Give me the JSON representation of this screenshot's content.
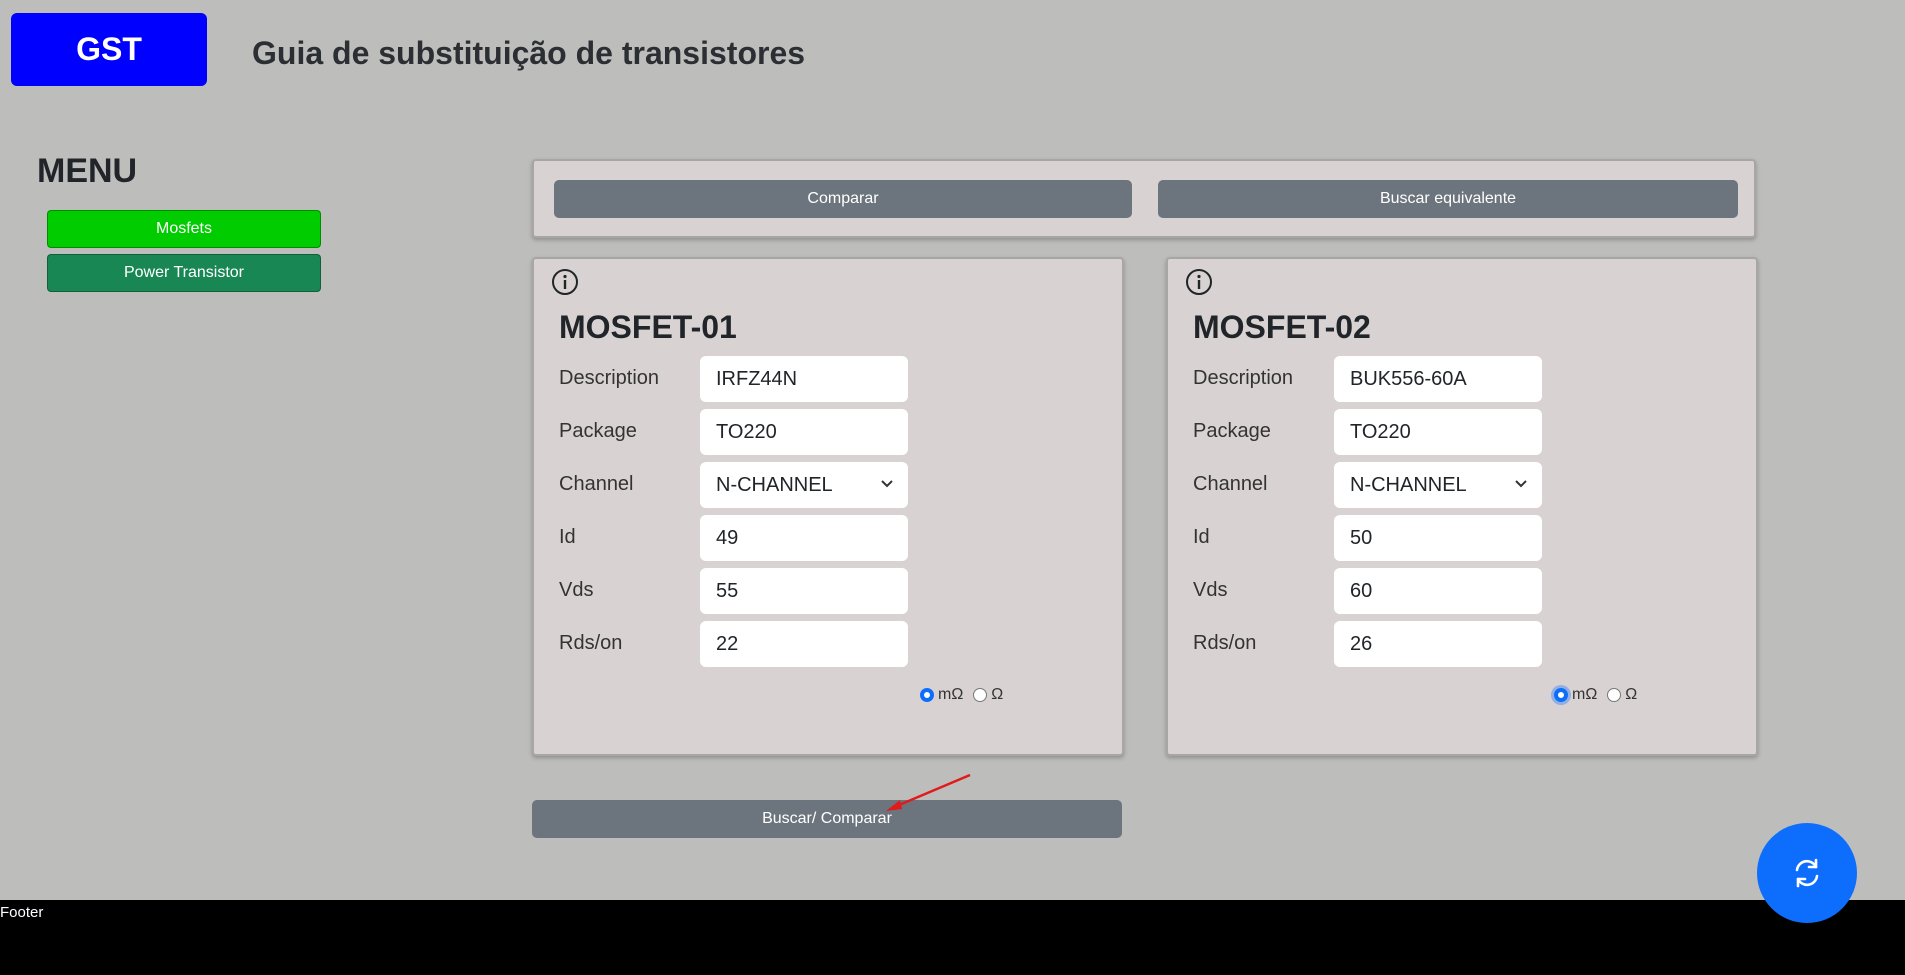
{
  "header": {
    "logo_text": "GST",
    "title": "Guia de substituição de transistores"
  },
  "menu": {
    "title": "MENU",
    "items": [
      {
        "label": "Mosfets",
        "color": "#00cc00"
      },
      {
        "label": "Power Transistor",
        "color": "#198754"
      }
    ]
  },
  "toolbar": {
    "compare_label": "Comparar",
    "find_equivalent_label": "Buscar equivalente"
  },
  "labels": {
    "description": "Description",
    "package": "Package",
    "channel": "Channel",
    "id": "Id",
    "vds": "Vds",
    "rds_on": "Rds/on",
    "unit_mohm": "mΩ",
    "unit_ohm": "Ω"
  },
  "cards": [
    {
      "title": "MOSFET-01",
      "description": "IRFZ44N",
      "package": "TO220",
      "channel": "N-CHANNEL",
      "id": "49",
      "vds": "55",
      "rds_on": "22",
      "unit_selected": "mΩ"
    },
    {
      "title": "MOSFET-02",
      "description": "BUK556-60A",
      "package": "TO220",
      "channel": "N-CHANNEL",
      "id": "50",
      "vds": "60",
      "rds_on": "26",
      "unit_selected": "mΩ"
    }
  ],
  "actions": {
    "search_compare_label": "Buscar/ Comparar"
  },
  "footer": {
    "text": "Footer"
  },
  "icons": {
    "info": "info-icon",
    "refresh": "refresh-icon",
    "chevron": "chevron-down-icon"
  },
  "colors": {
    "accent": "#0d6efd",
    "button_gray": "#6c757d",
    "logo_blue": "#0000ff"
  }
}
